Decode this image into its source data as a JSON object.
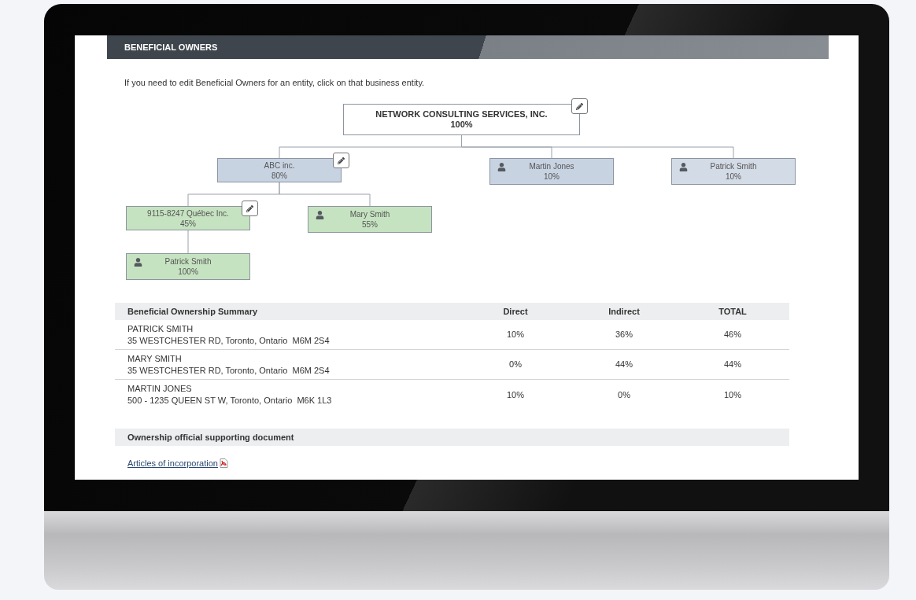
{
  "section": {
    "title": "BENEFICIAL OWNERS"
  },
  "instructions": "If you need to edit Beneficial Owners for an entity, click on that business entity.",
  "ownership_tree": {
    "kind": "entity",
    "name": "NETWORK CONSULTING SERVICES, INC.",
    "share": "100%",
    "color": "#ffffff",
    "children": [
      {
        "kind": "entity",
        "name": "ABC inc.",
        "share": "80%",
        "color": "#c8d3e2",
        "children": [
          {
            "kind": "entity",
            "name": "9115-8247 Québec Inc.",
            "share": "45%",
            "color": "#c6e3c1",
            "children": [
              {
                "kind": "person",
                "name": "Patrick Smith",
                "share": "100%",
                "color": "#c6e3c1"
              }
            ]
          },
          {
            "kind": "person",
            "name": "Mary Smith",
            "share": "55%",
            "color": "#c6e3c1"
          }
        ]
      },
      {
        "kind": "person",
        "name": "Martin Jones",
        "share": "10%",
        "color": "#c8d3e2"
      },
      {
        "kind": "person",
        "name": "Patrick Smith",
        "share": "10%",
        "color": "#d3dbe6"
      }
    ]
  },
  "summary_table": {
    "columns": [
      "Beneficial Ownership Summary",
      "Direct",
      "Indirect",
      "TOTAL"
    ],
    "rows": [
      {
        "name": "PATRICK SMITH",
        "address": "35 WESTCHESTER RD, Toronto, Ontario  M6M 2S4",
        "direct": "10%",
        "indirect": "36%",
        "total": "46%"
      },
      {
        "name": "MARY SMITH",
        "address": "35 WESTCHESTER RD, Toronto, Ontario  M6M 2S4",
        "direct": "0%",
        "indirect": "44%",
        "total": "44%"
      },
      {
        "name": "MARTIN JONES",
        "address": "500 - 1235 QUEEN ST W, Toronto, Ontario  M6K 1L3",
        "direct": "10%",
        "indirect": "0%",
        "total": "10%"
      }
    ]
  },
  "documents": {
    "title": "Ownership official supporting document",
    "links": [
      {
        "label": "Articles of incorporation"
      }
    ]
  }
}
